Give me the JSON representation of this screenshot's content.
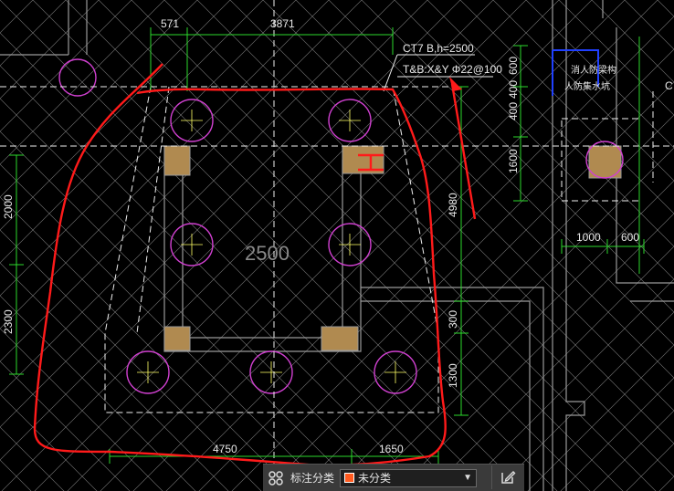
{
  "drawing": {
    "dims": {
      "top_left": "571",
      "top_mid": "3871",
      "left_upper": "2000",
      "left_lower": "2300",
      "bottom_left": "4750",
      "bottom_right": "1650",
      "right_upper": "4980",
      "right_lower_a": "300",
      "right_lower_b": "1300",
      "right_col_a": "600",
      "right_col_b": "400",
      "right_col_c": "400",
      "right_col_d": "1600",
      "far_right_a": "1000",
      "far_right_b": "600"
    },
    "cap_label": "2500",
    "annotation_line1": "CT7 B,h=2500",
    "annotation_line2": "T&B:X&Y Φ22@100",
    "right_block_line1": "消人防梁构",
    "right_block_line2": "人防集水坑",
    "right_edge_letter": "C"
  },
  "annotation_bar": {
    "label": "标注分类",
    "selected": "未分类",
    "swatch_color": "#ff5a1f"
  },
  "colors": {
    "green": "#2bd92b",
    "magenta": "#d040d0",
    "white": "#e8e8e8",
    "yellow": "#ffff66",
    "red": "#ff2020",
    "tan": "#c8a060",
    "grey": "#8a8a8a"
  }
}
